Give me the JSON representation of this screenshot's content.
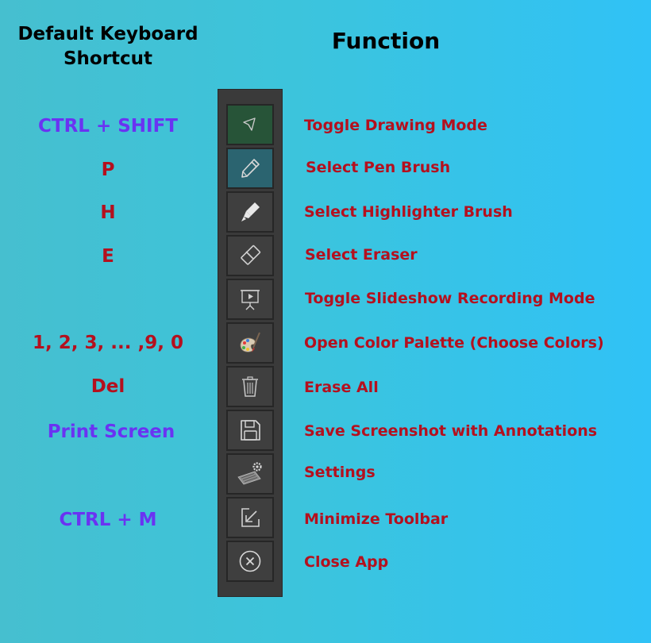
{
  "headers": {
    "shortcut": "Default Keyboard Shortcut",
    "function": "Function"
  },
  "colors": {
    "shortcut_blue": "#6a33f2",
    "shortcut_red": "#b4101e",
    "function_red": "#b4101e",
    "toolbar_bg": "#3a3a3a",
    "active_tool": "#275438",
    "selected_tool": "#2b6470"
  },
  "rows": [
    {
      "shortcut": "CTRL + SHIFT",
      "function": "Toggle Drawing Mode",
      "icon": "cursor-arrow-icon"
    },
    {
      "shortcut": "P",
      "function": "Select Pen Brush",
      "icon": "pen-icon"
    },
    {
      "shortcut": "H",
      "function": "Select Highlighter Brush",
      "icon": "highlighter-icon"
    },
    {
      "shortcut": "E",
      "function": "Select Eraser",
      "icon": "eraser-icon"
    },
    {
      "shortcut": "",
      "function": "Toggle Slideshow Recording Mode",
      "icon": "presentation-icon"
    },
    {
      "shortcut": "1, 2, 3, ... ,9, 0",
      "function": "Open Color Palette (Choose Colors)",
      "icon": "palette-icon"
    },
    {
      "shortcut": "Del",
      "function": "Erase All",
      "icon": "trash-icon"
    },
    {
      "shortcut": "Print Screen",
      "function": "Save Screenshot with Annotations",
      "icon": "save-icon"
    },
    {
      "shortcut": "",
      "function": "Settings",
      "icon": "keyboard-settings-icon"
    },
    {
      "shortcut": "CTRL + M",
      "function": "Minimize Toolbar",
      "icon": "minimize-icon"
    },
    {
      "shortcut": "",
      "function": "Close App",
      "icon": "close-icon"
    }
  ]
}
